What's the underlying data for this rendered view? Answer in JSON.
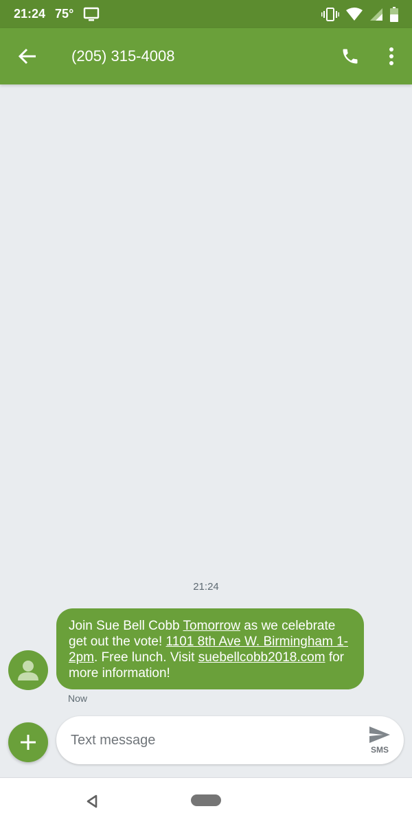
{
  "status_bar": {
    "time": "21:24",
    "temperature": "75°",
    "icons": [
      "cast-display-icon",
      "vibrate-icon",
      "wifi-icon",
      "cell-signal-icon",
      "battery-icon"
    ]
  },
  "app_bar": {
    "title": "(205) 315-4008",
    "icons": [
      "back-arrow-icon",
      "phone-icon",
      "more-vert-icon"
    ]
  },
  "conversation": {
    "timestamp": "21:24",
    "message": {
      "parts": [
        {
          "text": "Join Sue Bell Cobb ",
          "link": false
        },
        {
          "text": "Tomorrow",
          "link": true
        },
        {
          "text": " as we celebrate get out the vote! ",
          "link": false
        },
        {
          "text": "1101 8th Ave W. Birmingham 1-2pm",
          "link": true
        },
        {
          "text": ". Free lunch. Visit ",
          "link": false
        },
        {
          "text": "suebellcobb2018.com",
          "link": true
        },
        {
          "text": " for more information!",
          "link": false
        }
      ],
      "status": "Now"
    }
  },
  "composer": {
    "placeholder": "Text message",
    "value": "",
    "send_label": "SMS"
  },
  "colors": {
    "status_bar": "#5c8c2f",
    "accent": "#6aa03a",
    "background": "#e9ecef"
  }
}
